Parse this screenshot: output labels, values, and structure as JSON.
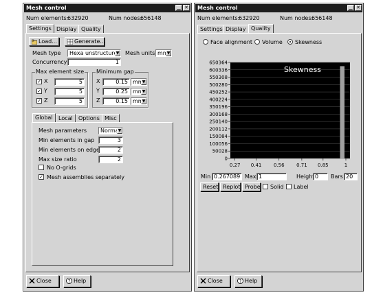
{
  "left_window": {
    "title": "Mesh control",
    "num_elements_label": "Num elements:",
    "num_elements_value": "632920",
    "num_nodes_label": "Num nodes:",
    "num_nodes_value": "656148",
    "tabs": [
      "Settings",
      "Display",
      "Quality"
    ],
    "active_tab": "Settings",
    "load_label": "Load...",
    "generate_label": "Generate...",
    "mesh_type_label": "Mesh type",
    "mesh_type_value": "Hexa unstructured",
    "mesh_units_label": "Mesh units",
    "mesh_units_value": "mm",
    "concurrency_label": "Concurrency",
    "concurrency_value": "1",
    "max_element_size": {
      "label": "Max element size",
      "x_label": "X",
      "x_value": "5",
      "y_label": "Y",
      "y_value": "5",
      "z_label": "Z",
      "z_value": "5"
    },
    "minimum_gap": {
      "label": "Minimum gap",
      "x_label": "X",
      "x_value": "0.15",
      "x_unit": "mm",
      "y_label": "Y",
      "y_value": "0.25",
      "y_unit": "mm",
      "z_label": "Z",
      "z_value": "0.15",
      "z_unit": "mm"
    },
    "sub_tabs": [
      "Global",
      "Local",
      "Options",
      "Misc"
    ],
    "active_sub_tab": "Global",
    "mesh_parameters_label": "Mesh parameters",
    "mesh_parameters_value": "Normal",
    "min_elements_gap_label": "Min elements in gap",
    "min_elements_gap_value": "3",
    "min_elements_edge_label": "Min elements on edge",
    "min_elements_edge_value": "2",
    "max_size_ratio_label": "Max size ratio",
    "max_size_ratio_value": "2",
    "no_ogrids_label": "No O-grids",
    "mesh_assemblies_label": "Mesh assemblies separately",
    "close_label": "Close",
    "help_label": "Help"
  },
  "right_window": {
    "title": "Mesh control",
    "num_elements_label": "Num elements:",
    "num_elements_value": "632920",
    "num_nodes_label": "Num nodes:",
    "num_nodes_value": "656148",
    "tabs": [
      "Settings",
      "Display",
      "Quality"
    ],
    "active_tab": "Quality",
    "face_alignment_label": "Face alignment",
    "volume_label": "Volume",
    "skewness_label": "Skewness",
    "selected_metric": "Skewness",
    "min_label": "Min",
    "min_value": "0.267089",
    "max_label": "Max",
    "max_value": "1",
    "height_label": "Height",
    "height_value": "0",
    "bars_label": "Bars",
    "bars_value": "20",
    "reset_label": "Reset",
    "replot_label": "Replot",
    "probe_label": "Probe",
    "solid_label": "Solid",
    "label_label": "Label",
    "close_label": "Close",
    "help_label": "Help"
  },
  "chart_data": {
    "type": "bar",
    "title": "Skewness",
    "x_ticks": [
      "0.27",
      "0.41",
      "0.56",
      "0.71",
      "0.85",
      "1"
    ],
    "y_ticks": [
      "0",
      "50028",
      "100056",
      "150084",
      "200112",
      "250140",
      "300168",
      "350196",
      "400224",
      "450252",
      "500280",
      "550308",
      "600336",
      "650364"
    ],
    "xlim": [
      0.267089,
      1
    ],
    "ylim": [
      0,
      650364
    ],
    "bins": 20,
    "bars": [
      {
        "x": 0.98,
        "value": 625000
      }
    ],
    "background": "#000000",
    "bar_color": "#a0a0a0"
  }
}
